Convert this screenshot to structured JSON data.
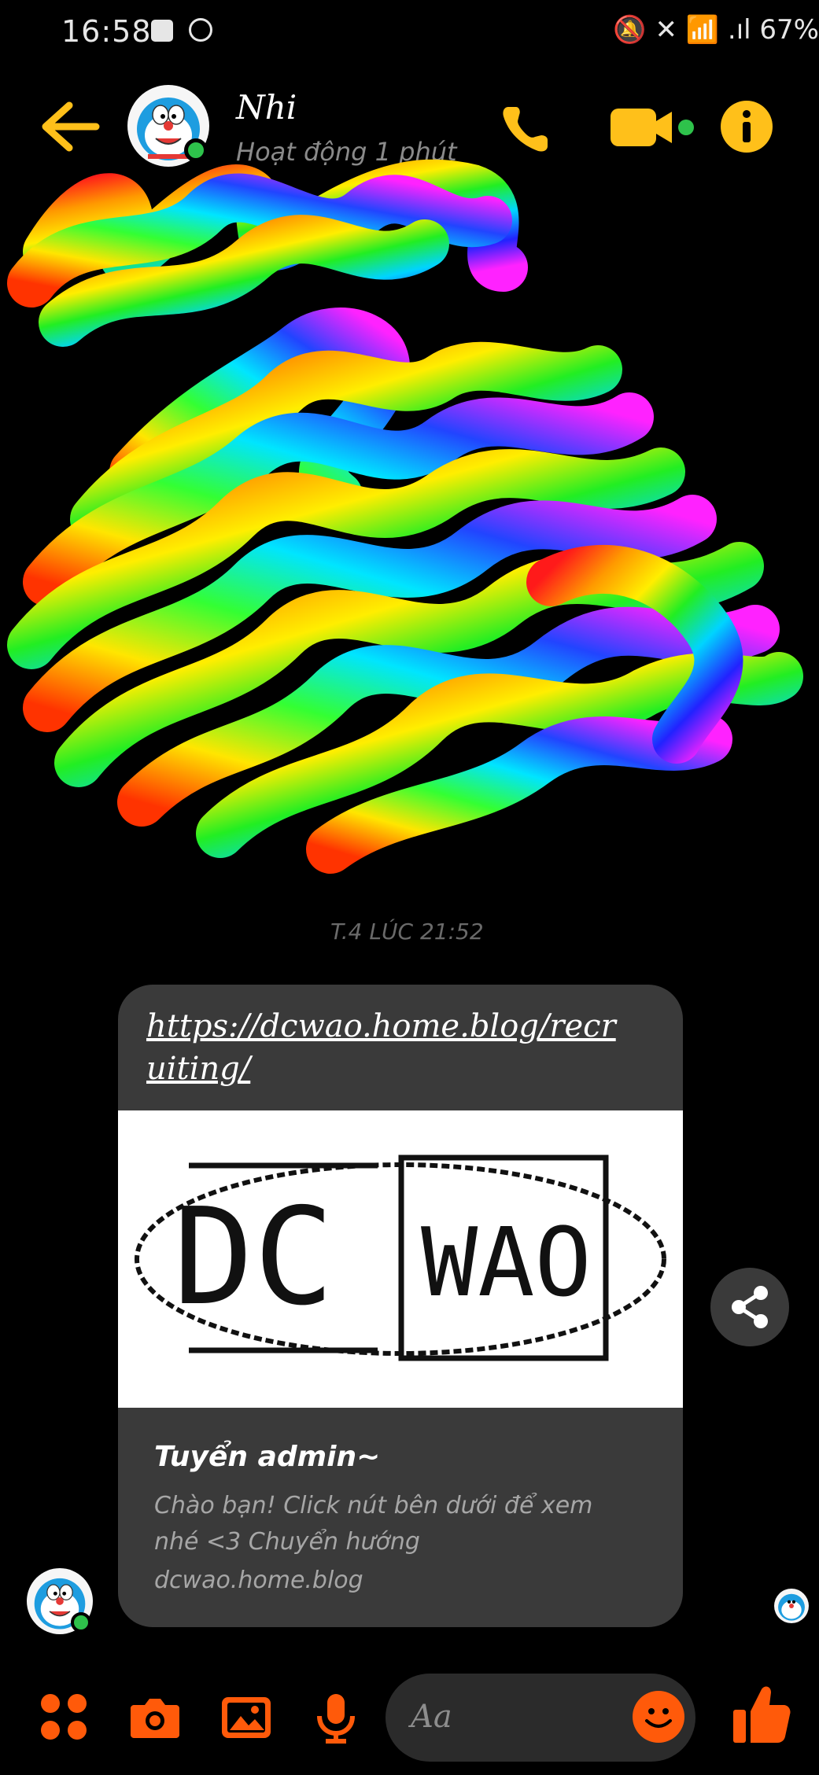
{
  "status_bar": {
    "time": "16:58",
    "right_text": "🔕 ✕ 📶 .ıl 67%"
  },
  "header": {
    "contact_name": "Nhi",
    "contact_status": "Hoạt động 1 phút"
  },
  "conversation": {
    "time_stamp": "T.4 LÚC 21:52",
    "link_card": {
      "url": "https://dcwao.home.blog/recruiting/",
      "image_text": "DCWAO",
      "title": "Tuyển admin~",
      "description": "Chào bạn! Click nút bên dưới để xem nhé <3 Chuyển hướng",
      "domain": "dcwao.home.blog"
    }
  },
  "composer": {
    "placeholder": "Aa"
  },
  "colors": {
    "accent": "#ffc01a",
    "composer_accent": "#ff5a0a",
    "online": "#2ec24b",
    "card_bg": "#3a3a3a"
  }
}
